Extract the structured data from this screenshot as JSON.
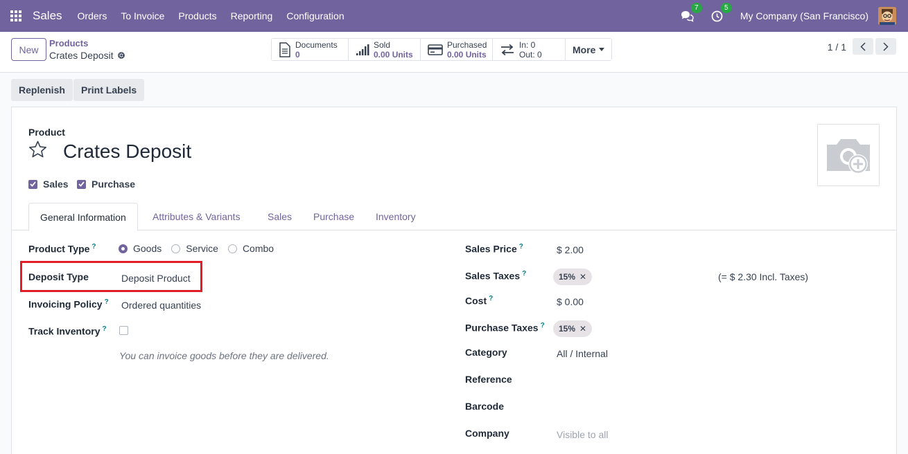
{
  "navbar": {
    "app_name": "Sales",
    "menu": [
      "Orders",
      "To Invoice",
      "Products",
      "Reporting",
      "Configuration"
    ],
    "messages_count": "7",
    "activities_count": "5",
    "company": "My Company (San Francisco)",
    "color": "#71639e"
  },
  "control_panel": {
    "new_label": "New",
    "breadcrumb_parent": "Products",
    "breadcrumb_current": "Crates Deposit",
    "smart_buttons": {
      "documents_label": "Documents",
      "documents_value": "0",
      "sold_label": "Sold",
      "sold_value": "0.00 Units",
      "purchased_label": "Purchased",
      "purchased_value": "0.00 Units",
      "in_label": "In: 0",
      "out_label": "Out: 0",
      "more_label": "More"
    },
    "pager": "1 / 1"
  },
  "actions": {
    "replenish": "Replenish",
    "print_labels": "Print Labels"
  },
  "form": {
    "product_label": "Product",
    "product_name": "Crates Deposit",
    "sales_check": "Sales",
    "purchase_check": "Purchase",
    "tabs": [
      "General Information",
      "Attributes & Variants",
      "Sales",
      "Purchase",
      "Inventory"
    ],
    "left": {
      "product_type_label": "Product Type",
      "product_type_options": [
        "Goods",
        "Service",
        "Combo"
      ],
      "deposit_type_label": "Deposit Type",
      "deposit_type_value": "Deposit Product",
      "invoicing_policy_label": "Invoicing Policy",
      "invoicing_policy_value": "Ordered quantities",
      "track_inventory_label": "Track Inventory",
      "note": "You can invoice goods before they are delivered."
    },
    "right": {
      "sales_price_label": "Sales Price",
      "sales_price_value": "$ 2.00",
      "sales_taxes_label": "Sales Taxes",
      "sales_taxes_tag": "15%",
      "incl_taxes": "(= $ 2.30 Incl. Taxes)",
      "cost_label": "Cost",
      "cost_value": "$ 0.00",
      "purchase_taxes_label": "Purchase Taxes",
      "purchase_taxes_tag": "15%",
      "category_label": "Category",
      "category_value": "All / Internal",
      "reference_label": "Reference",
      "barcode_label": "Barcode",
      "company_label": "Company",
      "company_placeholder": "Visible to all"
    },
    "help_mark": "?",
    "remove_mark": "✕"
  }
}
